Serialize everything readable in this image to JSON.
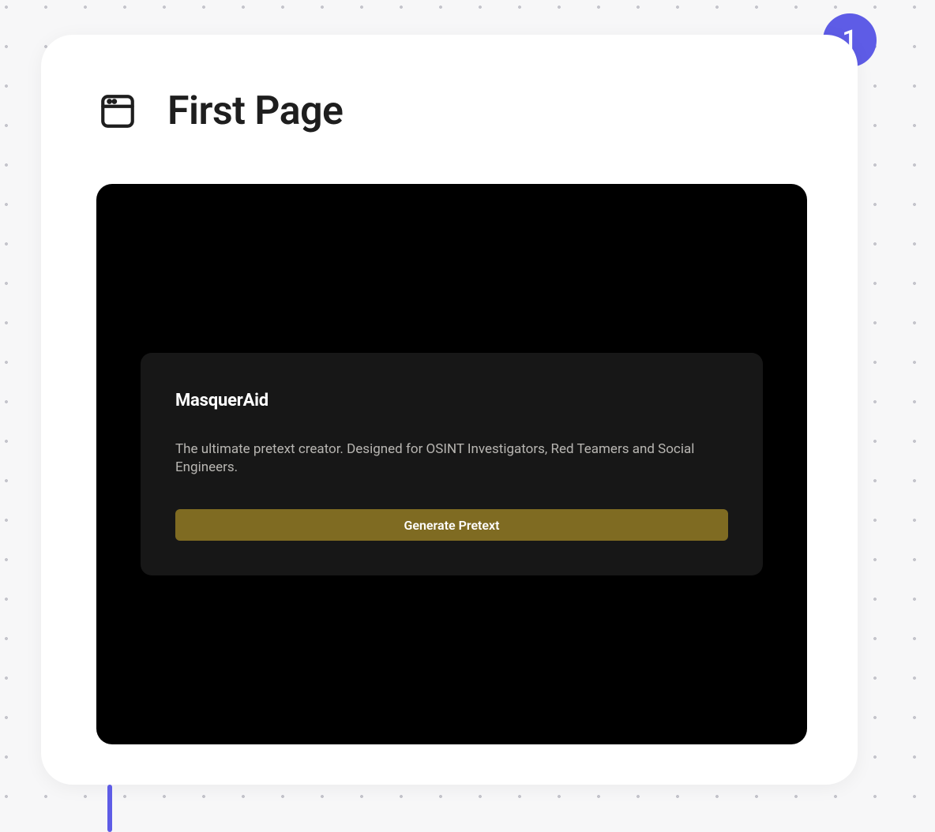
{
  "badge": {
    "number": "1"
  },
  "header": {
    "title": "First Page"
  },
  "preview": {
    "title": "MasquerAid",
    "description": "The ultimate pretext creator. Designed for OSINT Investigators, Red Teamers and Social Engineers.",
    "button_label": "Generate Pretext"
  }
}
